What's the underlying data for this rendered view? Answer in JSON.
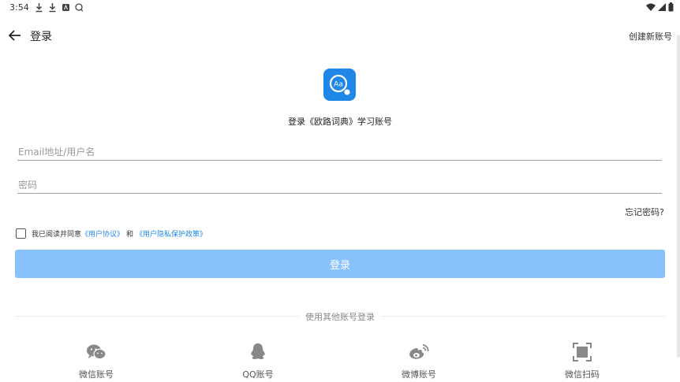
{
  "status_bar": {
    "time": "3:54"
  },
  "app_bar": {
    "title": "登录",
    "create_account": "创建新账号"
  },
  "logo": {
    "text": "Aa"
  },
  "subtitle": "登录《欧路词典》学习账号",
  "form": {
    "email_placeholder": "Email地址/用户名",
    "password_placeholder": "密码",
    "forgot": "忘记密码?"
  },
  "agreement": {
    "prefix": "我已阅读并同意",
    "user_agreement": "《用户协议》",
    "and": "和",
    "privacy_policy": "《用户隐私保护政策》"
  },
  "login_button": "登录",
  "divider_text": "使用其他账号登录",
  "social": [
    {
      "label": "微信账号",
      "icon": "wechat-icon"
    },
    {
      "label": "QQ账号",
      "icon": "qq-icon"
    },
    {
      "label": "微博账号",
      "icon": "weibo-icon"
    },
    {
      "label": "微信扫码",
      "icon": "scan-icon"
    }
  ],
  "colors": {
    "accent": "#1f87e8",
    "button_disabled": "#89c2fb"
  }
}
